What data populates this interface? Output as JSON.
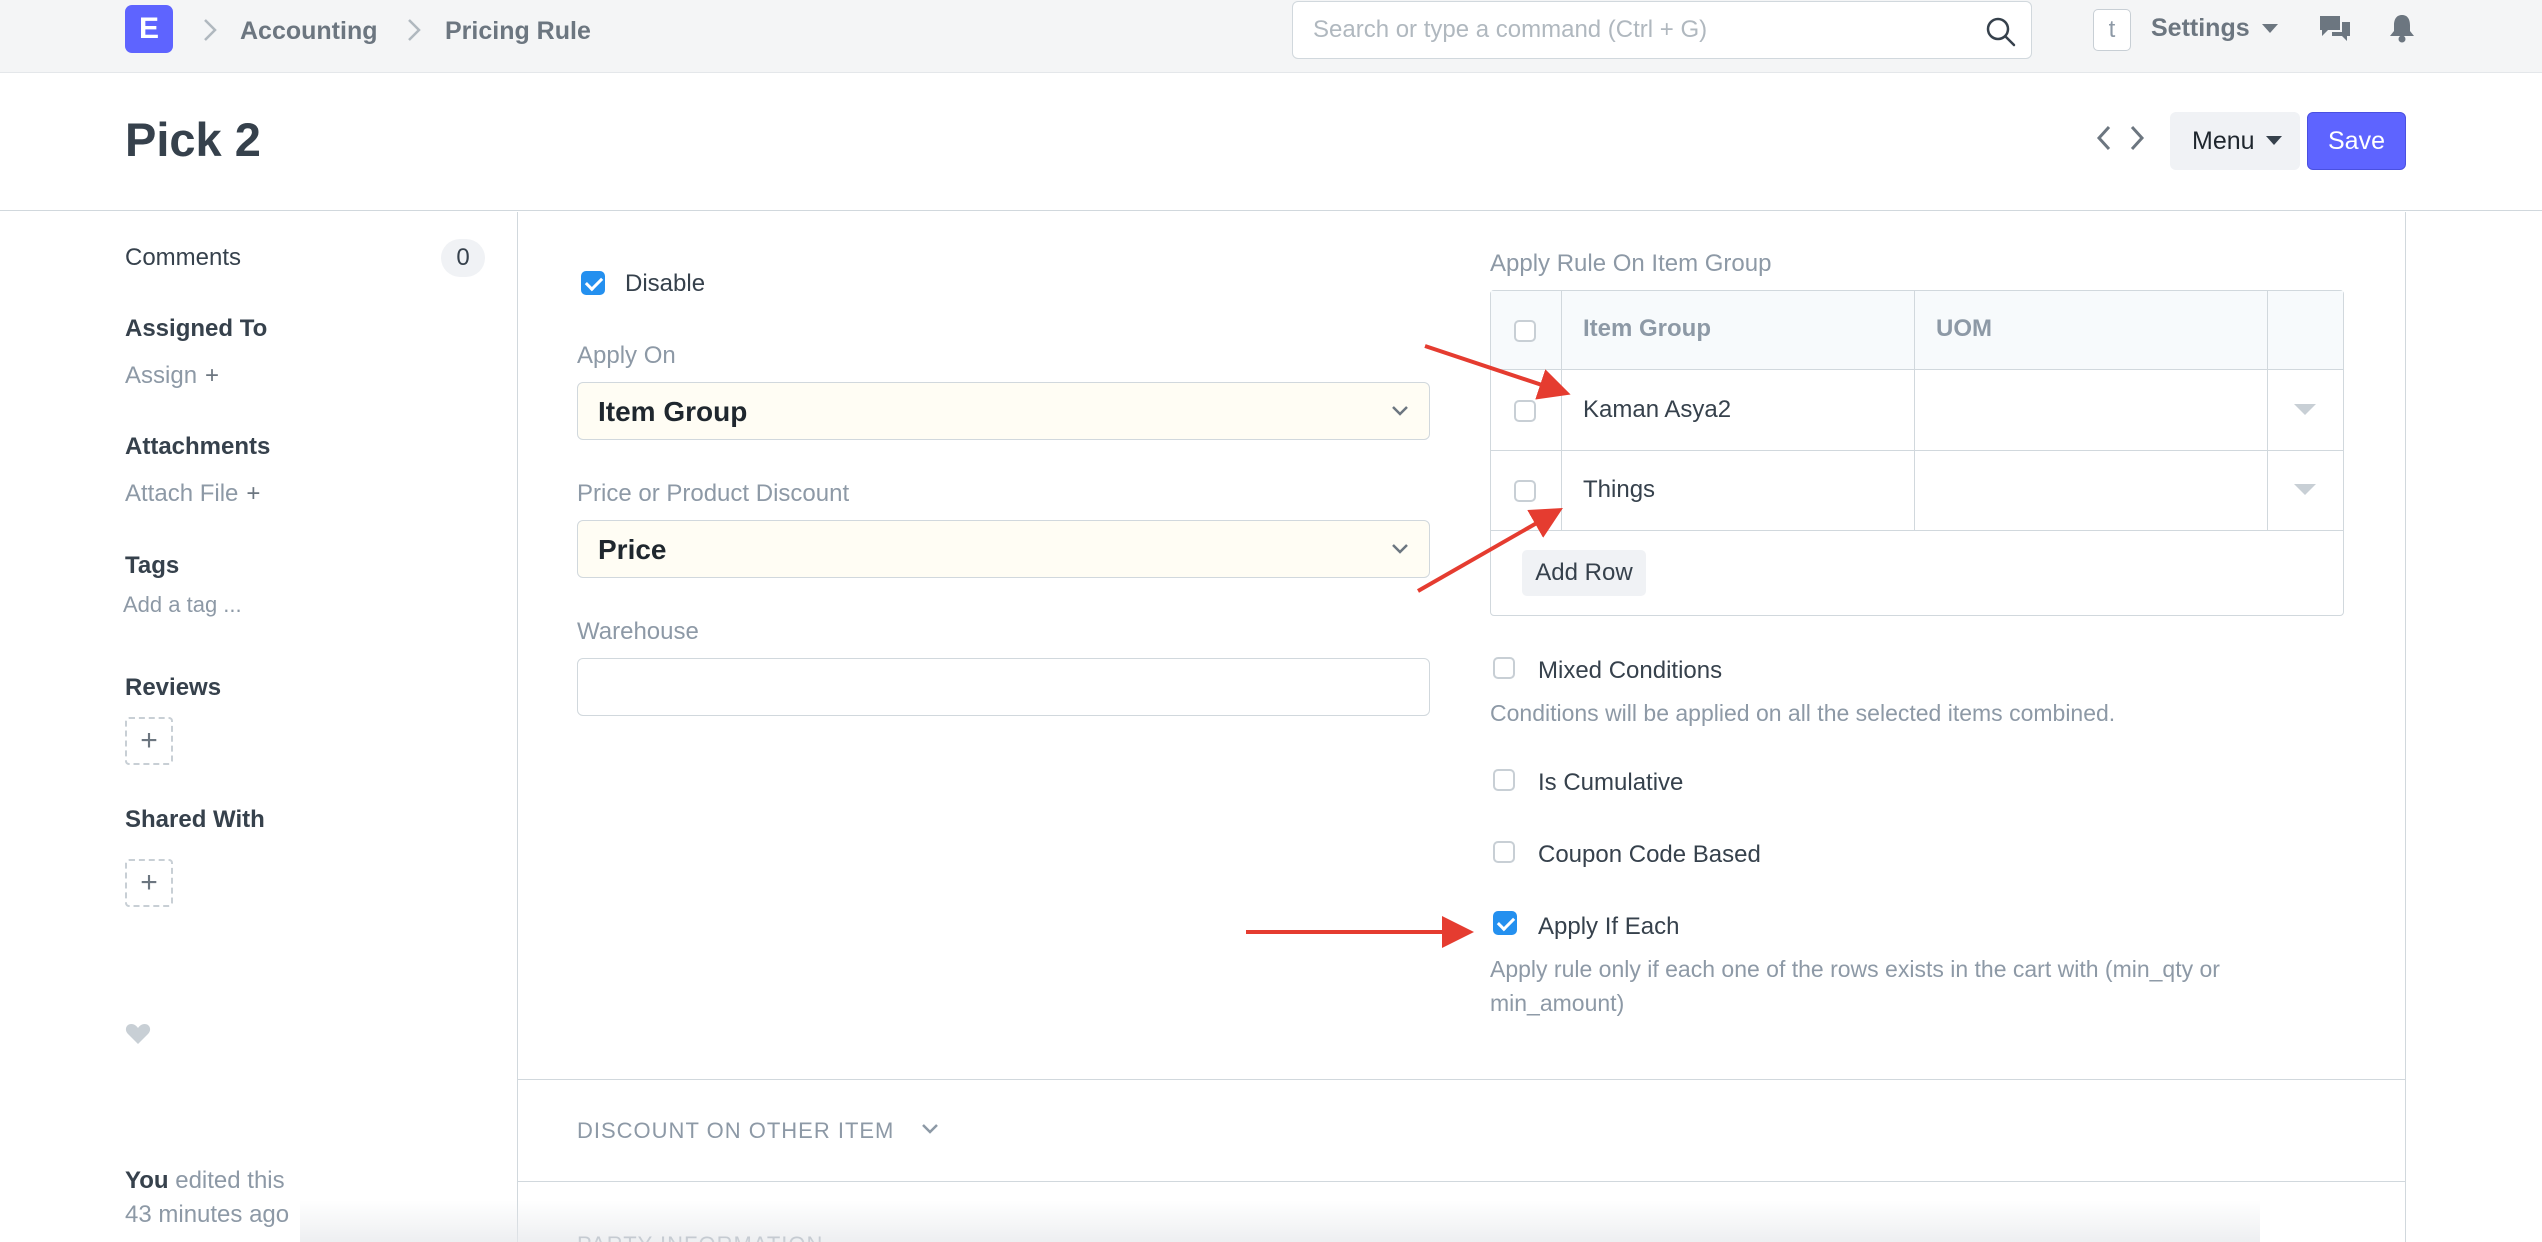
{
  "navbar": {
    "logo_letter": "E",
    "breadcrumbs": [
      "Accounting",
      "Pricing Rule"
    ],
    "search_placeholder": "Search or type a command (Ctrl + G)",
    "avatar_letter": "t",
    "settings_label": "Settings"
  },
  "page": {
    "title": "Pick 2",
    "menu_label": "Menu",
    "save_label": "Save"
  },
  "sidebar": {
    "comments_label": "Comments",
    "comments_count": "0",
    "assigned_to_heading": "Assigned To",
    "assign_link": "Assign",
    "attachments_heading": "Attachments",
    "attach_link": "Attach File",
    "tags_heading": "Tags",
    "add_tag_link": "Add a tag ...",
    "reviews_heading": "Reviews",
    "shared_heading": "Shared With",
    "modified_user": "You",
    "modified_text": "edited this",
    "modified_time": "43 minutes ago"
  },
  "form": {
    "disable_label": "Disable",
    "disable_checked": true,
    "apply_on_label": "Apply On",
    "apply_on_value": "Item Group",
    "price_or_product_label": "Price or Product Discount",
    "price_or_product_value": "Price",
    "warehouse_label": "Warehouse",
    "warehouse_value": "",
    "item_group_table_label": "Apply Rule On Item Group",
    "table_columns": [
      "Item Group",
      "UOM"
    ],
    "table_rows": [
      {
        "item_group": "Kaman Asya2",
        "uom": ""
      },
      {
        "item_group": "Things",
        "uom": ""
      }
    ],
    "add_row_label": "Add Row",
    "mixed_conditions_label": "Mixed Conditions",
    "mixed_conditions_help": "Conditions will be applied on all the selected items combined.",
    "is_cumulative_label": "Is Cumulative",
    "coupon_code_label": "Coupon Code Based",
    "apply_if_each_label": "Apply If Each",
    "apply_if_each_checked": true,
    "apply_if_each_help_1": "Apply rule only if each one of the rows exists in the cart with (min_qty or",
    "apply_if_each_help_2": "min_amount)"
  },
  "sections": {
    "discount_on_other_item": "DISCOUNT ON OTHER ITEM",
    "party_information": "PARTY INFORMATION"
  },
  "colors": {
    "primary": "#5e64ff",
    "checkbox": "#2490ef",
    "annotation_arrow": "#e53c30"
  }
}
